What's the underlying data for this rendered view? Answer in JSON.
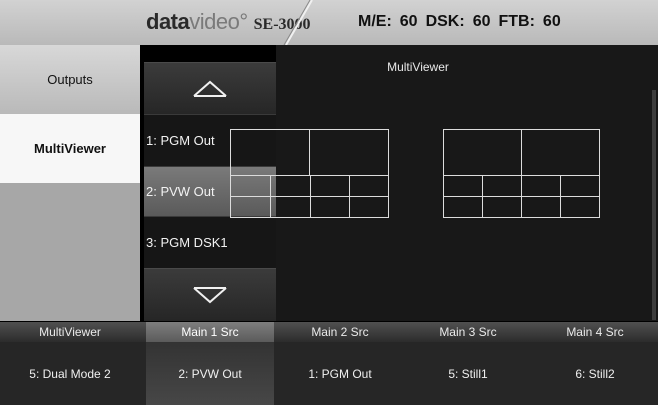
{
  "header": {
    "brand_primary": "data",
    "brand_secondary": "video",
    "brand_mark": "°",
    "model": "SE-3000",
    "status": {
      "me_label": "M/E:",
      "me_value": "60",
      "dsk_label": "DSK:",
      "dsk_value": "60",
      "ftb_label": "FTB:",
      "ftb_value": "60"
    }
  },
  "sidebar": {
    "items": [
      {
        "label": "Outputs"
      },
      {
        "label": "MultiViewer"
      }
    ]
  },
  "list": {
    "items": [
      {
        "label": "1: PGM Out"
      },
      {
        "label": "2: PVW Out"
      },
      {
        "label": "3: PGM DSK1"
      }
    ]
  },
  "main": {
    "title": "MultiViewer"
  },
  "bottom": {
    "headers": [
      "MultiViewer",
      "Main 1 Src",
      "Main 2 Src",
      "Main 3 Src",
      "Main 4 Src"
    ],
    "values": [
      "5: Dual Mode 2",
      "2: PVW Out",
      "1: PGM Out",
      "5: Still1",
      "6: Still2"
    ]
  },
  "colors": {
    "background": "#181818",
    "selected_sidebar": "#f7f7f7",
    "topbar": "#c5c5c5",
    "grid_lines": "#dcdcdc"
  },
  "icons": {
    "up": "chevron-up-icon",
    "down": "chevron-down-icon"
  }
}
